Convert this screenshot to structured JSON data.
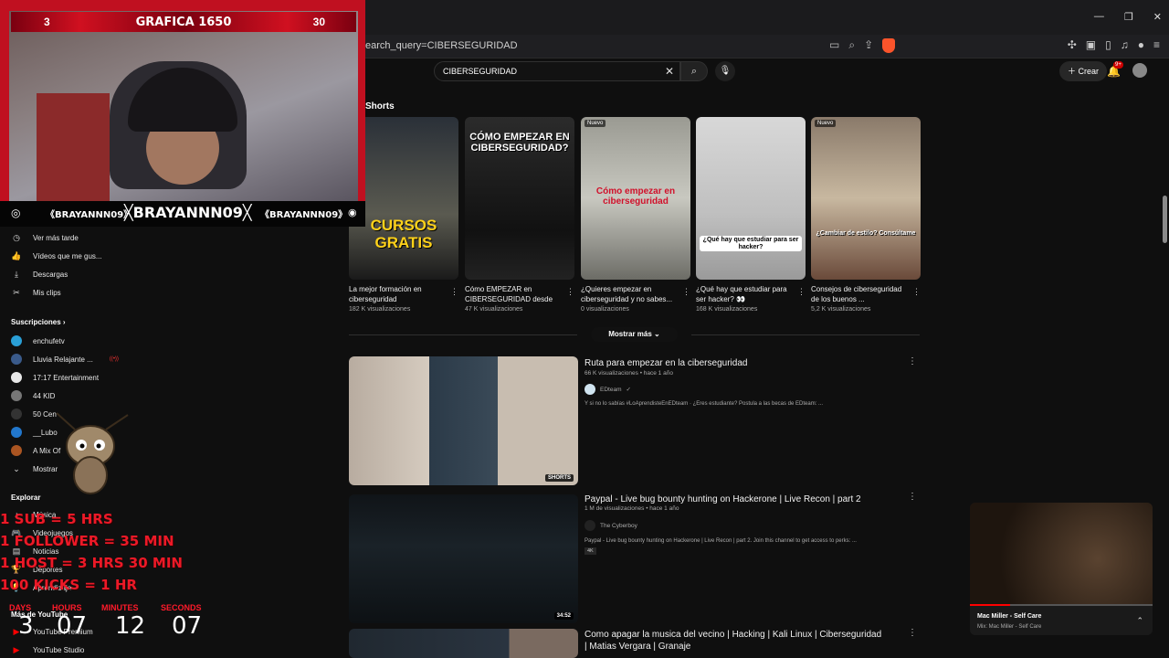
{
  "browser": {
    "url": "earch_query=CIBERSEGURIDAD",
    "window_controls": [
      "—",
      "❐",
      "✕"
    ]
  },
  "youtube": {
    "search": {
      "value": "CIBERSEGURIDAD"
    },
    "create_label": "Crear",
    "notification_count": "9+"
  },
  "sidebar": {
    "items": [
      {
        "label": "Ver más tarde",
        "icon": "clock-icon"
      },
      {
        "label": "Vídeos que me gus...",
        "icon": "thumbs-up-icon"
      },
      {
        "label": "Descargas",
        "icon": "download-icon"
      },
      {
        "label": "Mis clips",
        "icon": "scissors-icon"
      }
    ],
    "subscriptions_heading": "Suscripciones",
    "subscriptions": [
      {
        "label": "enchufetv",
        "color": "#2a9fd6",
        "live": false
      },
      {
        "label": "Lluvia Relajante ...",
        "color": "#3a5a8a",
        "live": true
      },
      {
        "label": "17:17 Entertainment",
        "color": "#e8e8e8",
        "live": false
      },
      {
        "label": "44 KID",
        "color": "#777777",
        "live": false
      },
      {
        "label": "50 Cen",
        "color": "#333333",
        "live": false
      },
      {
        "label": "__Lubo",
        "color": "#2277cc",
        "live": false
      },
      {
        "label": "A Mix Of",
        "color": "#aa5522",
        "live": false
      }
    ],
    "show_more": "Mostrar",
    "explore_heading": "Explorar",
    "explore": [
      {
        "label": "Música"
      },
      {
        "label": "Videojuegos"
      },
      {
        "label": "Noticias"
      },
      {
        "label": "Deportes"
      },
      {
        "label": "Aprendizaje"
      }
    ],
    "more_heading": "Más de YouTube",
    "more": [
      {
        "label": "YouTube Premium"
      },
      {
        "label": "YouTube Studio"
      }
    ]
  },
  "shorts": {
    "title": "Shorts",
    "items": [
      {
        "overlay": "CURSOS GRATIS",
        "title": "La mejor formación en ciberseguridad",
        "views": "182 K visualizaciones",
        "new": false
      },
      {
        "overlay": "CÓMO EMPEZAR EN CIBERSEGURIDAD?",
        "title": "Cómo EMPEZAR en CIBERSEGURIDAD desde ...",
        "views": "47 K visualizaciones",
        "new": false
      },
      {
        "overlay": "Cómo empezar en ciberseguridad",
        "title": "¿Quieres empezar en ciberseguridad y no sabes...",
        "views": "0 visualizaciones",
        "new": true
      },
      {
        "overlay": "¿Qué hay que estudiar para ser hacker?",
        "title": "¿Qué hay que estudiar para ser hacker? 👀",
        "views": "168 K visualizaciones",
        "new": false
      },
      {
        "overlay": "¿Cambiar de estilo? Consúltame",
        "title": "Consejos de ciberseguridad de los buenos ...",
        "views": "5,2 K visualizaciones",
        "new": true
      }
    ],
    "new_label": "Nuevo",
    "show_more": "Mostrar más"
  },
  "videos": [
    {
      "title": "Ruta para empezar en la ciberseguridad",
      "meta": "66 K visualizaciones • hace 1 año",
      "channel": "EDteam",
      "desc": "Y si no lo sabías #LoAprendisteEnEDteam · ¿Eres estudiante? Postula a las becas de EDteam: ...",
      "badge": "SHORTS"
    },
    {
      "title": "Paypal - Live bug bounty hunting on Hackerone | Live Recon | part 2",
      "meta": "1 M de visualizaciones • hace 1 año",
      "channel": "The Cyberboy",
      "desc": "Paypal - Live bug bounty hunting on Hackerone | Live Recon | part 2. Join this channel to get access to perks: ...",
      "badge": "34:52",
      "tag": "4K"
    },
    {
      "title": "Como apagar la musica del vecino | Hacking | Kali Linux | Ciberseguridad | Matias Vergara | Granaje"
    }
  ],
  "stream": {
    "cam_left": "3",
    "cam_title": "GRAFICA 1650",
    "cam_right": "30",
    "handle_small": "《BRAYANNN09》",
    "handle_big": "╳BRAYANNN09╳",
    "subathon": [
      "1 SUB = 5 HRS",
      "1 FOLLOWER = 35 MIN",
      "1 HOST = 3 HRS 30 MIN",
      "100 KICKS = 1 HR"
    ],
    "timer_labels": [
      "DAYS",
      "HOURS",
      "MINUTES",
      "SECONDS"
    ],
    "timer_values": [
      "3",
      "07",
      "12",
      "07"
    ]
  },
  "mini_player": {
    "title": "Mac Miller - Self Care",
    "subtitle": "Mix: Mac Miller - Self Care",
    "progress": 0.22
  },
  "colors": {
    "accent": "#ff0000",
    "stream_red": "#c01020"
  }
}
